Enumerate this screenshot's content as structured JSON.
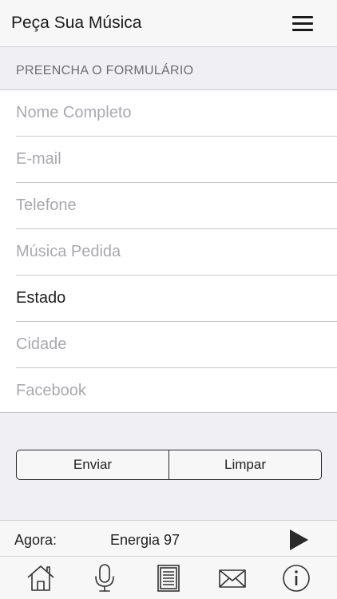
{
  "header": {
    "title": "Peça Sua Música",
    "menu_icon": "hamburger-menu-icon"
  },
  "form": {
    "section_title": "PREENCHA O FORMULÁRIO",
    "fields": [
      {
        "placeholder": "Nome Completo",
        "value": ""
      },
      {
        "placeholder": "E-mail",
        "value": ""
      },
      {
        "placeholder": "Telefone",
        "value": ""
      },
      {
        "placeholder": "Música Pedida",
        "value": ""
      },
      {
        "selected": "Estado"
      },
      {
        "placeholder": "Cidade",
        "value": ""
      },
      {
        "placeholder": "Facebook",
        "value": ""
      }
    ],
    "submit_label": "Enviar",
    "clear_label": "Limpar"
  },
  "player": {
    "now_label": "Agora:",
    "station": "Energia 97",
    "play_icon": "play-icon"
  },
  "tabbar": {
    "icons": [
      "home-icon",
      "microphone-icon",
      "news-icon",
      "mail-icon",
      "info-icon"
    ]
  },
  "colors": {
    "background": "#efeff4",
    "bar": "#f7f7f7",
    "placeholder": "#a9a9ae",
    "separator": "#c8c7cc"
  }
}
